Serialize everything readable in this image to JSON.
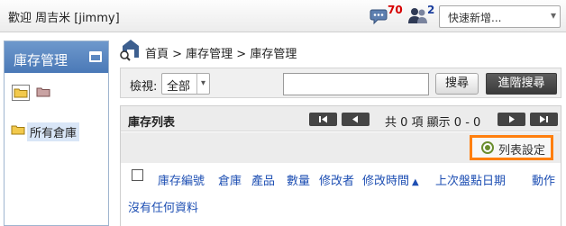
{
  "topbar": {
    "welcome": "歡迎 周吉米 [jimmy]",
    "messages_count": "70",
    "users_count": "2",
    "quick_add_placeholder": "快速新增...",
    "icons": [
      "speech-bubble-icon",
      "users-icon",
      "chevron-down-icon"
    ]
  },
  "sidebar": {
    "title": "庫存管理",
    "tools": [
      "folder-icon",
      "folder-icon"
    ],
    "tree": [
      {
        "label": "所有倉庫",
        "icon": "folder-icon"
      }
    ]
  },
  "breadcrumb": {
    "text": "首頁 > 庫存管理 > 庫存管理",
    "icon": "warehouse-search-icon"
  },
  "search": {
    "view_label": "檢視:",
    "view_value": "全部",
    "query": "",
    "search_button": "搜尋",
    "advanced_button": "進階搜尋"
  },
  "list": {
    "title": "庫存列表",
    "pagination": "共 0 項 顯示 0 - 0",
    "settings_button": "列表設定",
    "columns": [
      "庫存編號",
      "倉庫",
      "產品",
      "數量",
      "修改者",
      "修改時間",
      "上次盤點日期",
      "動作"
    ],
    "sort_column": "修改時間",
    "empty_message": "沒有任何資料"
  },
  "colors": {
    "header_blue": "#5b87c2",
    "highlight_orange": "#ff7f0e",
    "link_blue": "#1e4fb3",
    "badge_red": "#d60000",
    "badge_blue": "#1a3d9c"
  }
}
